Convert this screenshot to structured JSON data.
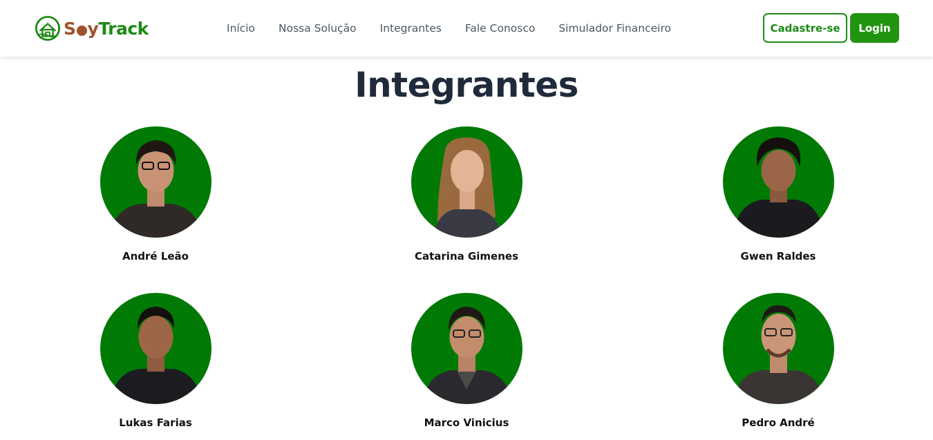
{
  "brand": {
    "name_part1": "S",
    "name_part2": "y",
    "name_part3": "Track",
    "icon": "farm-globe-icon",
    "colors": {
      "soy": "#a0522d",
      "track": "#1d8a14"
    }
  },
  "nav": {
    "links": [
      "Início",
      "Nossa Solução",
      "Integrantes",
      "Fale Conosco",
      "Simulador Financeiro"
    ]
  },
  "actions": {
    "register_label": "Cadastre-se",
    "login_label": "Login"
  },
  "page": {
    "title": "Integrantes"
  },
  "members": [
    {
      "name": "André Leão",
      "photo": "person-photo"
    },
    {
      "name": "Catarina Gimenes",
      "photo": "person-photo"
    },
    {
      "name": "Gwen Raldes",
      "photo": "person-photo"
    },
    {
      "name": "Lukas Farias",
      "photo": "person-photo"
    },
    {
      "name": "Marco Vinicius",
      "photo": "person-photo"
    },
    {
      "name": "Pedro André",
      "photo": "person-photo"
    }
  ],
  "colors": {
    "accent": "#239412",
    "avatar_bg": "#007a05",
    "title": "#1f2a3a"
  }
}
